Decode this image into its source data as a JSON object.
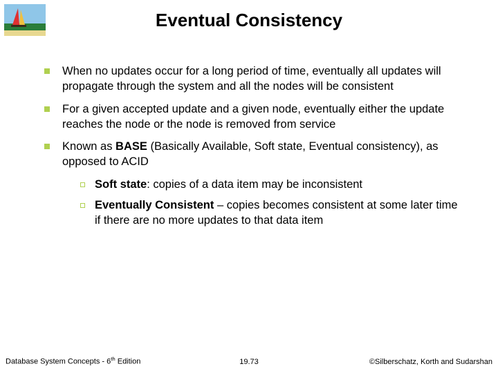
{
  "title": "Eventual Consistency",
  "bullets": {
    "b0": "When no updates occur for a long period of time, eventually all updates will propagate through the system and all the nodes will be consistent",
    "b1": "For a given accepted update and a given node, eventually either the update reaches the node or the node is removed from service",
    "b2_pre": "Known as ",
    "b2_bold": "BASE",
    "b2_post": " (Basically Available, Soft state, Eventual consistency), as opposed to ACID",
    "s0_bold": "Soft state",
    "s0_rest": ": copies of a data item may be inconsistent",
    "s1_bold": "Eventually Consistent",
    "s1_rest": " – copies becomes consistent at some later time if there are no more updates to that data item"
  },
  "footer": {
    "left_pre": "Database System Concepts - 6",
    "left_sup": "th",
    "left_post": " Edition",
    "center": "19.73",
    "right": "©Silberschatz, Korth and Sudarshan"
  },
  "colors": {
    "bullet": "#b0d050"
  }
}
